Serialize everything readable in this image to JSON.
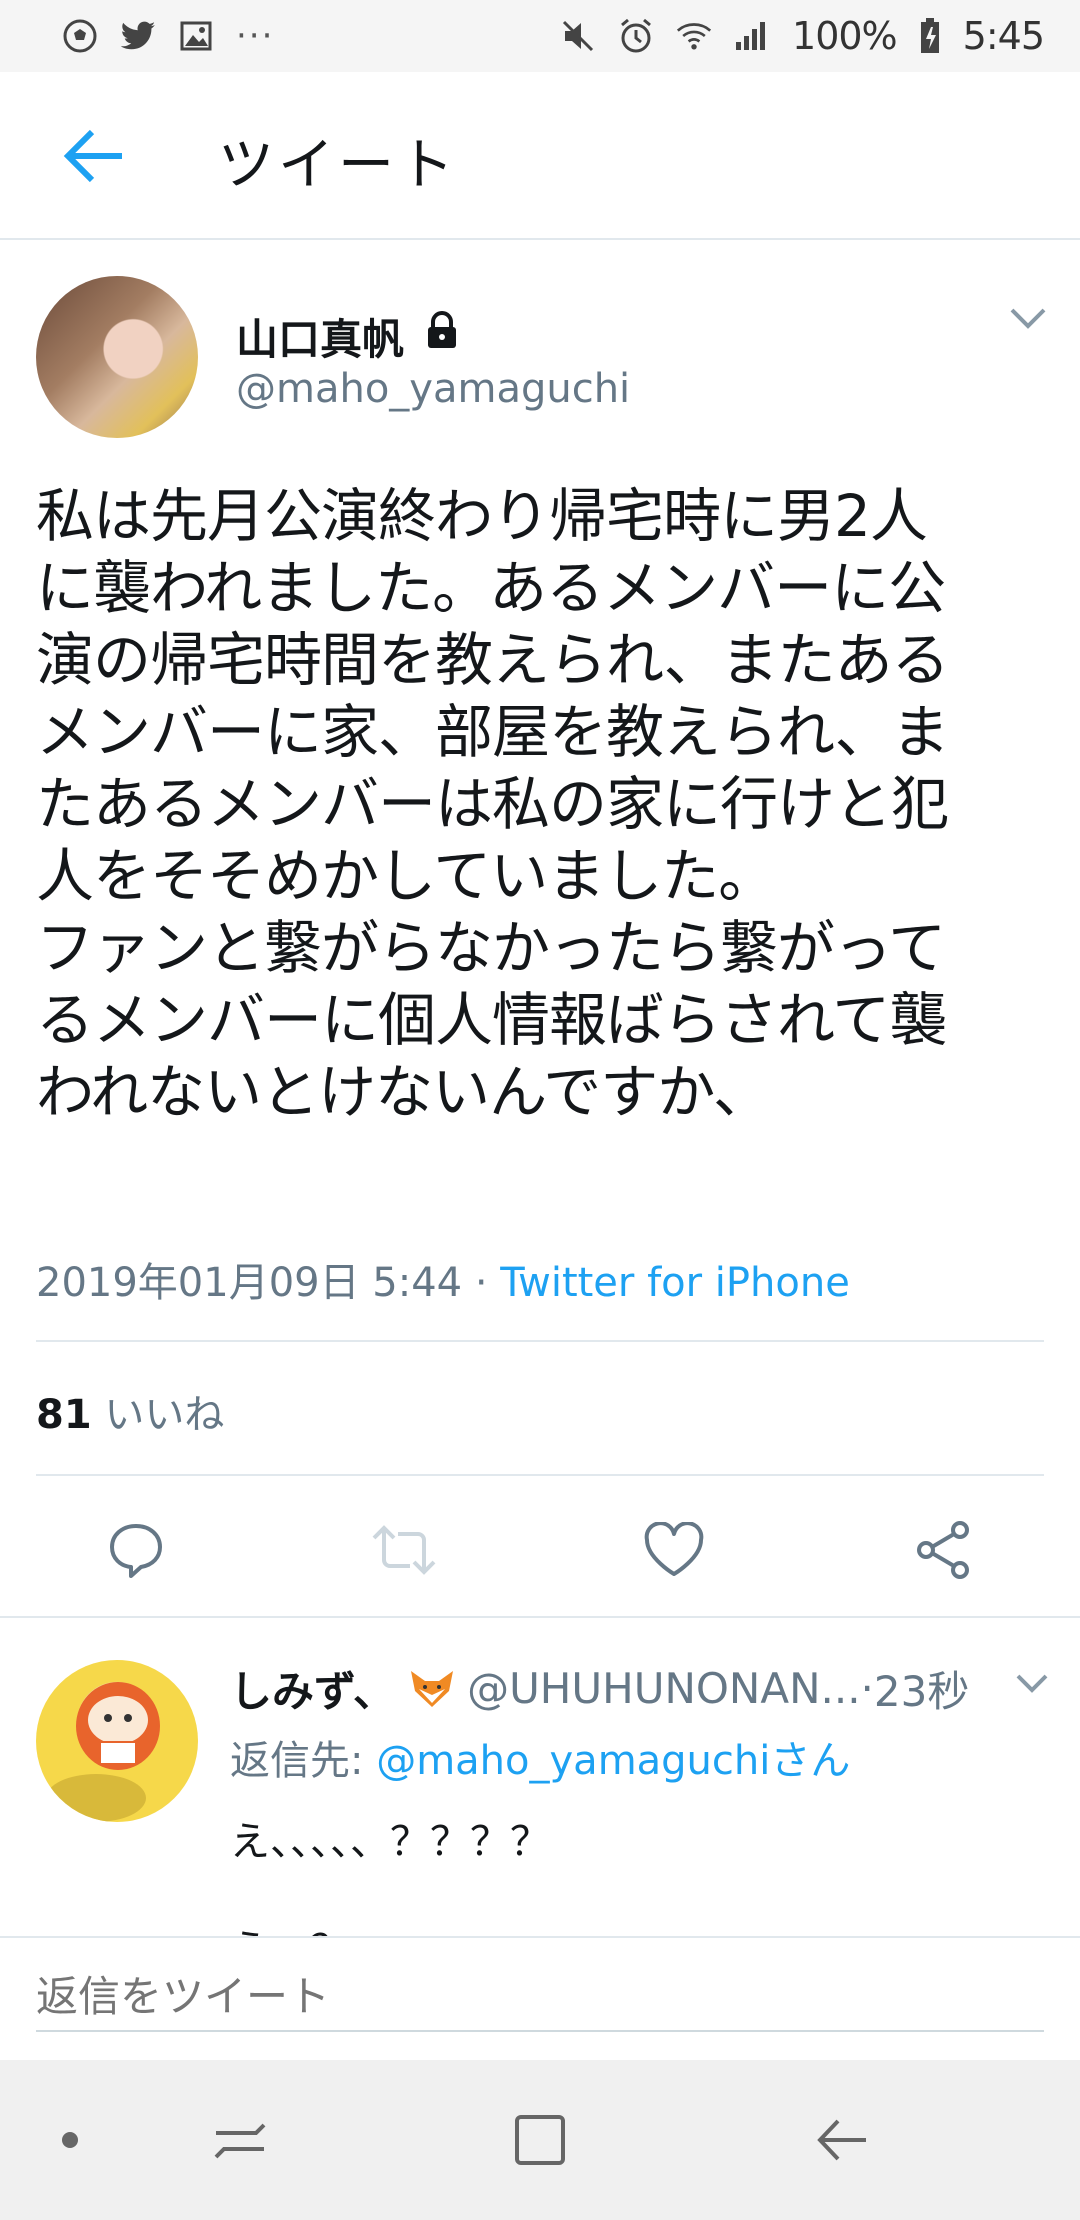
{
  "status_bar": {
    "icons_left": [
      "soccer-ball-icon",
      "twitter-bird-icon",
      "image-icon",
      "more-dots-icon"
    ],
    "dots": "···",
    "icons_right": [
      "mute-icon",
      "alarm-icon",
      "wifi-icon",
      "signal-icon",
      "battery-icon"
    ],
    "battery": "100%",
    "time": "5:45"
  },
  "header": {
    "back_icon": "arrow-left-icon",
    "title": "ツイート",
    "accent": "#1da1f2"
  },
  "tweet": {
    "author_name": "山口真帆",
    "protected_icon": "lock-icon",
    "handle": "@maho_yamaguchi",
    "body": "私は先月公演終わり帰宅時に男2人\nに襲われました。あるメンバーに公\n演の帰宅時間を教えられ、またある\nメンバーに家、部屋を教えられ、ま\nたあるメンバーは私の家に行けと犯\n人をそそめかしていました。\nファンと繋がらなかったら繋がって\nるメンバーに個人情報ばらされて襲\nわれないとけないんですか、",
    "timestamp": "2019年01月09日 5:44",
    "separator": " · ",
    "source": "Twitter for iPhone",
    "likes_count": "81",
    "likes_label": "いいね",
    "actions": [
      "reply-icon",
      "retweet-icon",
      "like-icon",
      "share-icon"
    ]
  },
  "reply": {
    "name": "しみず、",
    "emoji_icon": "fox-icon",
    "handle": "@UHUHUNONAN...",
    "time_sep": " · ",
    "time": "23秒",
    "reply_to_label": "返信先: ",
    "reply_to_handle": "@maho_yamaguchiさん",
    "text": "え、、、、、？？？？\nえ、？"
  },
  "composer": {
    "placeholder": "返信をツイート"
  },
  "nav_bar": {
    "buttons": [
      "dot-icon",
      "recent-apps-icon",
      "home-icon",
      "back-icon"
    ]
  }
}
